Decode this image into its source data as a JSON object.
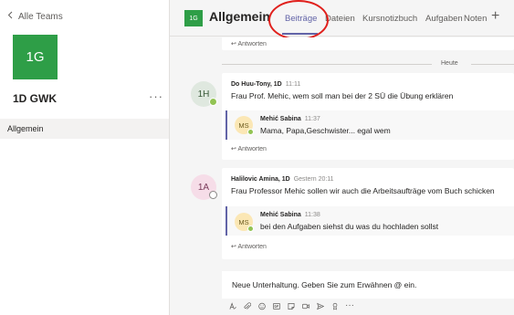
{
  "sidebar": {
    "back_label": "Alle Teams",
    "team_initials": "1G",
    "team_name": "1D GWK",
    "more_label": "···",
    "channels": [
      {
        "label": "Allgemein"
      }
    ]
  },
  "header": {
    "channel_initials": "1G",
    "channel_name": "Allgemein",
    "tabs": [
      {
        "label": "Beiträge",
        "active": true
      },
      {
        "label": "Dateien"
      },
      {
        "label": "Kursnotizbuch"
      },
      {
        "label": "Aufgaben"
      },
      {
        "label": "Noten"
      }
    ],
    "add_tab_label": "+"
  },
  "feed": {
    "reply_label": "Antworten",
    "day_divider": "Heute",
    "threads": [
      {
        "avatar": "1H",
        "author": "Do Huu-Tony, 1D",
        "time": "11:11",
        "text": "Frau Prof. Mehic, wem soll man bei der 2 SÜ die Übung erklären",
        "reply": {
          "avatar": "MS",
          "author": "Mehić Sabina",
          "time": "11:37",
          "text": "Mama, Papa,Geschwister... egal wem"
        }
      },
      {
        "avatar": "1A",
        "author": "Halilovic Amina, 1D",
        "time": "Gestern 20:11",
        "text": "Frau Professor Mehic sollen wir auch die Arbeitsaufträge vom Buch schicken",
        "reply": {
          "avatar": "MS",
          "author": "Mehić Sabina",
          "time": "11:38",
          "text": "bei den Aufgaben siehst du was du hochladen sollst"
        }
      }
    ]
  },
  "compose": {
    "placeholder": "Neue Unterhaltung. Geben Sie zum Erwähnen @ ein."
  },
  "toolbar": {
    "icons": [
      "format-icon",
      "attach-icon",
      "emoji-icon",
      "gif-icon",
      "sticker-icon",
      "meet-icon",
      "send-icon",
      "praise-icon",
      "more-icon"
    ]
  },
  "colors": {
    "accent": "#6264a7",
    "team_green": "#2e9e47",
    "highlight_red": "#e0201c",
    "avatar_teal": "#dfe8df",
    "avatar_pink": "#f6dde8",
    "avatar_yellow": "#fbe7b5",
    "presence_green": "#92c353"
  }
}
